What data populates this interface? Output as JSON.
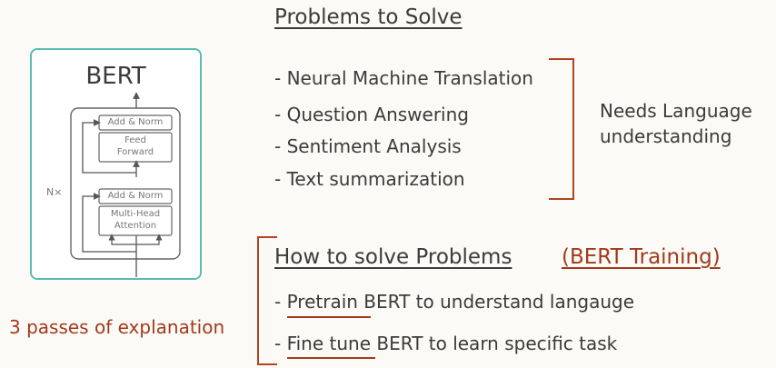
{
  "problems": {
    "heading": "Problems to Solve",
    "items": [
      "- Neural Machine Translation",
      "- Question Answering",
      "- Sentiment Analysis",
      "- Text summarization"
    ],
    "note_line1": "Needs Language",
    "note_line2": "understanding"
  },
  "bert_diagram": {
    "title": "BERT",
    "nx_label": "N×",
    "add_norm_top": "Add & Norm",
    "feed_forward_line1": "Feed",
    "feed_forward_line2": "Forward",
    "add_norm_bottom": "Add & Norm",
    "attention_line1": "Multi-Head",
    "attention_line2": "Attention",
    "border_color": "#5bbcb3"
  },
  "explanation_label": "3 passes of explanation",
  "solve": {
    "heading": "How to solve Problems",
    "heading_tag": "(BERT Training)",
    "steps": [
      {
        "prefix": "- ",
        "keyword": "Pretrain",
        "rest": " BERT to understand langauge"
      },
      {
        "prefix": "- ",
        "keyword": "Fine tune",
        "rest": " BERT to learn specific task"
      }
    ]
  },
  "colors": {
    "accent_red": "#a13a1a",
    "bracket": "#b2451f",
    "teal": "#5bbcb3",
    "text": "#3b3b3b"
  }
}
